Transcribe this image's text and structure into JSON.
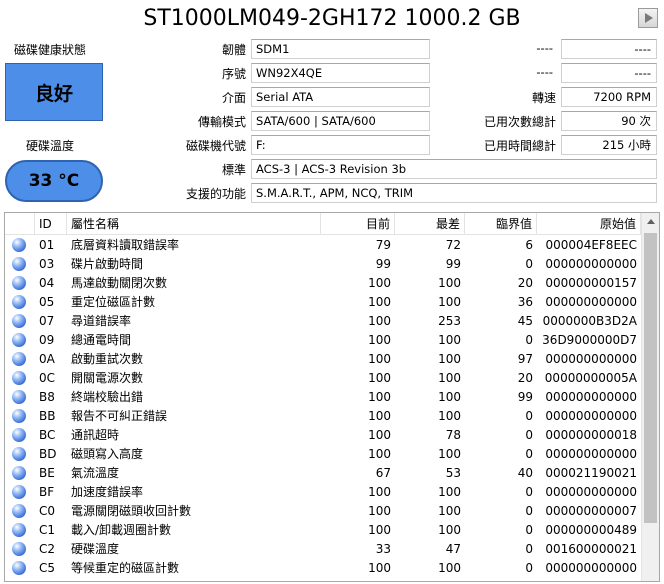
{
  "title": "ST1000LM049-2GH172 1000.2 GB",
  "health": {
    "label": "磁碟健康狀態",
    "status": "良好",
    "color": "#4d8ee8"
  },
  "temperature": {
    "label": "硬碟溫度",
    "value": "33 °C"
  },
  "fields": {
    "firmware": {
      "label": "韌體",
      "value": "SDM1"
    },
    "serial": {
      "label": "序號",
      "value": "WN92X4QE"
    },
    "interface": {
      "label": "介面",
      "value": "Serial ATA"
    },
    "transfer": {
      "label": "傳輸模式",
      "value": "SATA/600 | SATA/600"
    },
    "drive_letter": {
      "label": "磁碟機代號",
      "value": "F:"
    },
    "standard": {
      "label": "標準",
      "value": "ACS-3 | ACS-3 Revision 3b"
    },
    "features": {
      "label": "支援的功能",
      "value": "S.M.A.R.T., APM, NCQ, TRIM"
    },
    "r1": {
      "label": "",
      "value": "----"
    },
    "r1b": {
      "value": "----"
    },
    "r2": {
      "label": "",
      "value": "----"
    },
    "r2b": {
      "value": "----"
    },
    "rotation": {
      "label": "轉速",
      "value": "7200 RPM"
    },
    "power_count": {
      "label": "已用次數總計",
      "value": "90 次"
    },
    "power_hours": {
      "label": "已用時間總計",
      "value": "215 小時"
    }
  },
  "table": {
    "headers": {
      "id": "ID",
      "name": "屬性名稱",
      "current": "目前",
      "worst": "最差",
      "threshold": "臨界值",
      "raw": "原始值"
    },
    "rows": [
      {
        "id": "01",
        "name": "底層資料讀取錯誤率",
        "current": "79",
        "worst": "72",
        "threshold": "6",
        "raw": "000004EF8EEC"
      },
      {
        "id": "03",
        "name": "碟片啟動時間",
        "current": "99",
        "worst": "99",
        "threshold": "0",
        "raw": "000000000000"
      },
      {
        "id": "04",
        "name": "馬達啟動關閉次數",
        "current": "100",
        "worst": "100",
        "threshold": "20",
        "raw": "000000000157"
      },
      {
        "id": "05",
        "name": "重定位磁區計數",
        "current": "100",
        "worst": "100",
        "threshold": "36",
        "raw": "000000000000"
      },
      {
        "id": "07",
        "name": "尋道錯誤率",
        "current": "100",
        "worst": "253",
        "threshold": "45",
        "raw": "0000000B3D2A"
      },
      {
        "id": "09",
        "name": "總通電時間",
        "current": "100",
        "worst": "100",
        "threshold": "0",
        "raw": "36D9000000D7"
      },
      {
        "id": "0A",
        "name": "啟動重試次數",
        "current": "100",
        "worst": "100",
        "threshold": "97",
        "raw": "000000000000"
      },
      {
        "id": "0C",
        "name": "開關電源次數",
        "current": "100",
        "worst": "100",
        "threshold": "20",
        "raw": "00000000005A"
      },
      {
        "id": "B8",
        "name": "終端校驗出錯",
        "current": "100",
        "worst": "100",
        "threshold": "99",
        "raw": "000000000000"
      },
      {
        "id": "BB",
        "name": "報告不可糾正錯誤",
        "current": "100",
        "worst": "100",
        "threshold": "0",
        "raw": "000000000000"
      },
      {
        "id": "BC",
        "name": "通訊超時",
        "current": "100",
        "worst": "78",
        "threshold": "0",
        "raw": "000000000018"
      },
      {
        "id": "BD",
        "name": "磁頭寫入高度",
        "current": "100",
        "worst": "100",
        "threshold": "0",
        "raw": "000000000000"
      },
      {
        "id": "BE",
        "name": "氣流溫度",
        "current": "67",
        "worst": "53",
        "threshold": "40",
        "raw": "000021190021"
      },
      {
        "id": "BF",
        "name": "加速度錯誤率",
        "current": "100",
        "worst": "100",
        "threshold": "0",
        "raw": "000000000000"
      },
      {
        "id": "C0",
        "name": "電源關閉磁頭收回計數",
        "current": "100",
        "worst": "100",
        "threshold": "0",
        "raw": "000000000007"
      },
      {
        "id": "C1",
        "name": "載入/卸載週圈計數",
        "current": "100",
        "worst": "100",
        "threshold": "0",
        "raw": "000000000489"
      },
      {
        "id": "C2",
        "name": "硬碟溫度",
        "current": "33",
        "worst": "47",
        "threshold": "0",
        "raw": "001600000021"
      },
      {
        "id": "C5",
        "name": "等候重定的磁區計數",
        "current": "100",
        "worst": "100",
        "threshold": "0",
        "raw": "000000000000"
      }
    ]
  }
}
